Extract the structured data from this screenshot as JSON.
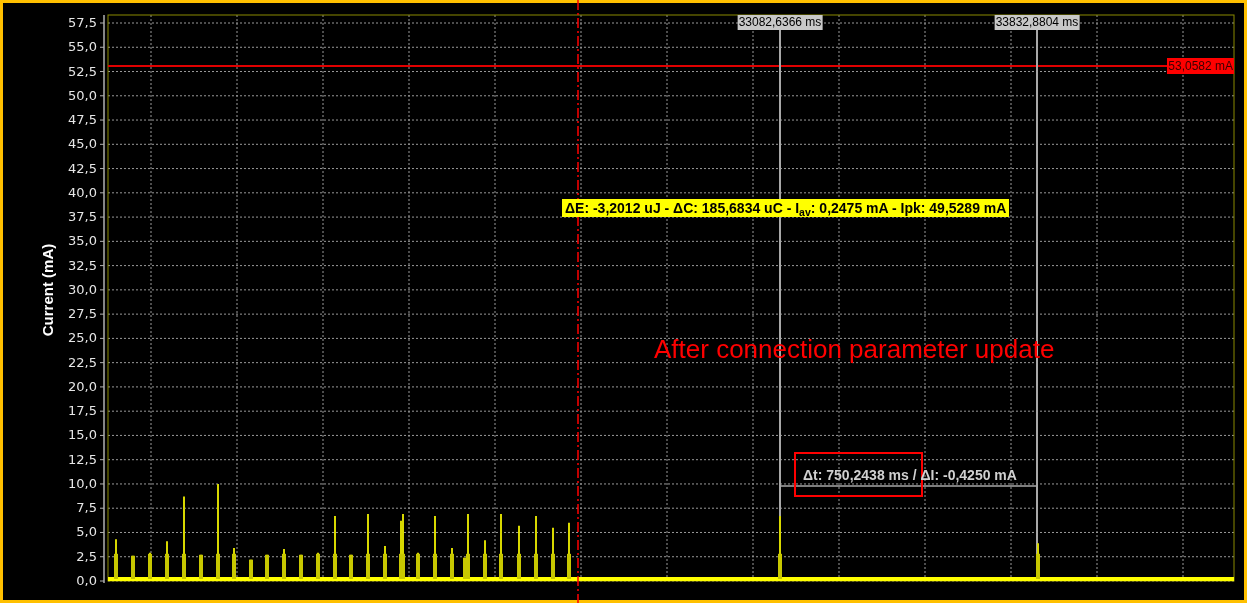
{
  "y_axis": {
    "label": "Current (mA)",
    "ticks": [
      "57,5",
      "55,0",
      "52,5",
      "50,0",
      "47,5",
      "45,0",
      "42,5",
      "40,0",
      "37,5",
      "35,0",
      "32,5",
      "30,0",
      "27,5",
      "25,0",
      "22,5",
      "20,0",
      "17,5",
      "15,0",
      "12,5",
      "10,0",
      "7,5",
      "5,0",
      "2,5",
      "0,0"
    ]
  },
  "cursors": [
    {
      "time": "33082,6366 ms"
    },
    {
      "time": "33832,8804 ms"
    }
  ],
  "threshold": {
    "value": "53,0582 mA"
  },
  "measurement": "ΔE: -3,2012 uJ - ΔC: 185,6834 uC - I$_{av}$: 0,2475 mA - Ipk: 49,5289 mA",
  "delta": "Δt: 750,2438 ms / ΔI: -0,4250 mA",
  "annotation": "After connection parameter update"
}
